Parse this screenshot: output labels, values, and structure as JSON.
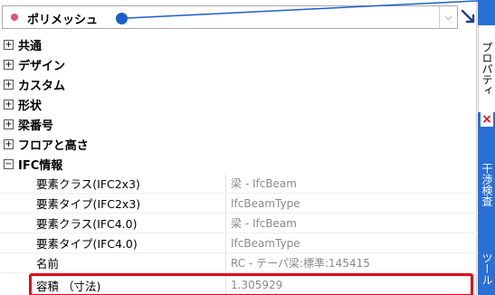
{
  "selector": {
    "value": "ポリメッシュ"
  },
  "categories": [
    {
      "label": "共通",
      "expanded": false
    },
    {
      "label": "デザイン",
      "expanded": false
    },
    {
      "label": "カスタム",
      "expanded": false
    },
    {
      "label": "形状",
      "expanded": false
    },
    {
      "label": "梁番号",
      "expanded": false
    },
    {
      "label": "フロアと高さ",
      "expanded": false
    },
    {
      "label": "IFC情報",
      "expanded": true
    }
  ],
  "toggle": {
    "collapsed": "+",
    "expanded": "−"
  },
  "ifc_rows": [
    {
      "name": "要素クラス(IFC2x3)",
      "value": "梁 - IfcBeam"
    },
    {
      "name": "要素タイプ(IFC2x3)",
      "value": "IfcBeamType"
    },
    {
      "name": "要素クラス(IFC4.0)",
      "value": "梁 - IfcBeam"
    },
    {
      "name": "要素タイプ(IFC4.0)",
      "value": "IfcBeamType"
    },
    {
      "name": "名前",
      "value": "RC - テーパ梁:標準:145415"
    },
    {
      "name": "容積 （寸法)",
      "value": "1.305929"
    }
  ],
  "sidebar": {
    "tab_properties": "プロパティ",
    "close": "×",
    "tab_second": "干渉検査",
    "tab_third": "ツール"
  },
  "colors": {
    "accent_blue": "#2a6fd6",
    "highlight_red": "#e8001c",
    "selector_dot": "#e0566a"
  }
}
